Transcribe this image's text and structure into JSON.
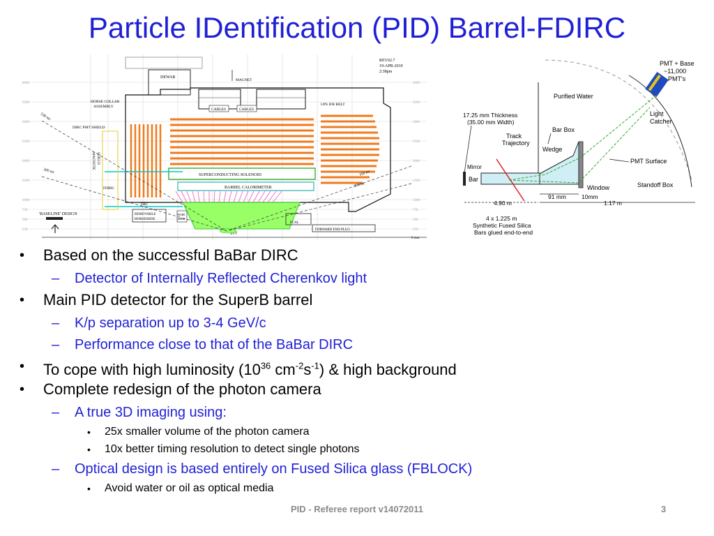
{
  "slide": {
    "title": "Particle IDentification (PID) Barrel-FDIRC",
    "footer": "PID - Referee report v14072011",
    "page_number": "3"
  },
  "left_figure": {
    "revision": [
      "REV02.7",
      "19-APR-2010",
      "2:38pm"
    ],
    "labels": {
      "dewar": "DEWAR",
      "magnet": "MAGNET",
      "horse_collar": "HORSE COLLAR",
      "assembly": "ASSEMBLY",
      "cables1": "CABLES",
      "cables2": "CABLES",
      "ups_ifr": "UPS IFR BELT",
      "dirc_pmt": "DIRC PMT SHIELD",
      "magnetic": "MAGNETIC",
      "shield": "SHIELD",
      "sc_solenoid": "SUPERCONDUCTING SOLENOID",
      "barrel_cal": "BARREL CALORIMETER",
      "fdirc": "FDIRC",
      "drc": "DRC",
      "baseline": "'BASELINE' DESIGN",
      "removable": "REMOVABLE",
      "horseshoe": "HORSESHOE",
      "bore": "BORE",
      "shim": "SHIM",
      "fcal": "FCAL",
      "forward_plug": "FORWARD END PLUG",
      "svt": "SVT",
      "mr530": "530 mr",
      "mr300a": "300 mr",
      "mr350": "350 mr",
      "mr300b": "300 mr",
      "zero": "0 mm"
    },
    "ruler_left": [
      "4000",
      "3500",
      "3000",
      "2500",
      "2000",
      "1500",
      "1000",
      "750",
      "500",
      "250"
    ],
    "ruler_right": [
      "4000",
      "3500",
      "3000",
      "2500",
      "2000",
      "1500",
      "1000",
      "750",
      "500",
      "250"
    ]
  },
  "right_figure": {
    "pmt_base": "PMT + Base",
    "pmt_count": "~11,000",
    "pmts": "PMT's",
    "purified_water": "Purified Water",
    "light": "Light",
    "catcher": "Catcher",
    "thickness": "17.25 mm Thickness",
    "width": "(35.00 mm Width)",
    "track": "Track",
    "trajectory": "Trajectory",
    "bar_box": "Bar Box",
    "wedge": "Wedge",
    "pmt_surface": "PMT Surface",
    "mirror": "Mirror",
    "bar": "Bar",
    "window": "Window",
    "standoff_box": "Standoff Box",
    "dim_490": "4.90 m",
    "dim_91": "91 mm",
    "dim_10": "10mm",
    "dim_117": "1.17 m",
    "bars_dim": "4 x 1.225 m",
    "silica1": "Synthetic Fused Silica",
    "silica2": "Bars glued end-to-end"
  },
  "bullets": {
    "b1": "Based on the successful BaBar DIRC",
    "b1_1": "Detector of Internally Reflected Cherenkov light",
    "b2": "Main PID detector for the SuperB barrel",
    "b2_1": "K/p separation up to 3-4 GeV/c",
    "b2_2": "Performance close to that of the BaBar DIRC",
    "b3_pre": "To cope with high luminosity (10",
    "b3_exp1": "36",
    "b3_mid1": " cm",
    "b3_exp2": "-2",
    "b3_mid2": "s",
    "b3_exp3": "-1",
    "b3_post": ") & high background",
    "b4": "Complete redesign of the photon camera",
    "b4_1": "A true 3D imaging using:",
    "b4_1_1": "25x smaller volume of the photon camera",
    "b4_1_2": "10x better timing resolution to detect single photons",
    "b4_2": "Optical design is based entirely on Fused Silica glass (FBLOCK)",
    "b4_2_1": "Avoid water or oil as optical media"
  },
  "colors": {
    "title": "#1f1fd6",
    "sub_bullet": "#1f1fd6",
    "calorimeter": "#f07a1c",
    "solenoid_green": "#33cc33",
    "svt_green": "#99ff66",
    "magenta": "#ee66cc",
    "cyan": "#00c8c8",
    "footer": "#8a8a8a"
  }
}
